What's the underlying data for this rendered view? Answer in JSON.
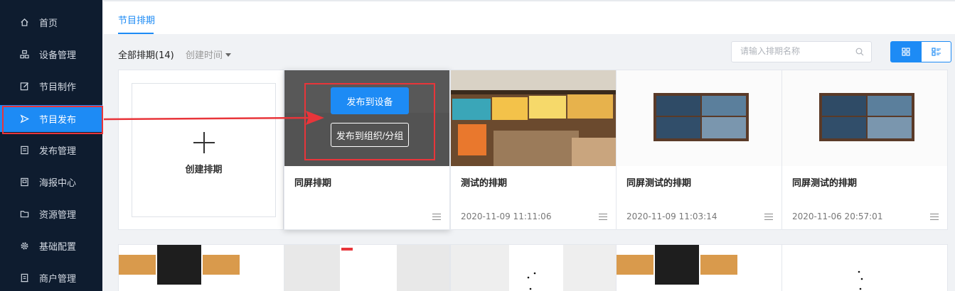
{
  "sidebar": {
    "items": [
      {
        "label": "首页",
        "icon": "home-icon"
      },
      {
        "label": "设备管理",
        "icon": "device-icon"
      },
      {
        "label": "节目制作",
        "icon": "edit-icon"
      },
      {
        "label": "节目发布",
        "icon": "send-icon",
        "active": true
      },
      {
        "label": "发布管理",
        "icon": "list-icon"
      },
      {
        "label": "海报中心",
        "icon": "poster-icon"
      },
      {
        "label": "资源管理",
        "icon": "folder-icon"
      },
      {
        "label": "基础配置",
        "icon": "gear-icon"
      },
      {
        "label": "商户管理",
        "icon": "merchant-icon"
      }
    ]
  },
  "tabs": [
    {
      "label": "节目排期",
      "active": true
    }
  ],
  "filter": {
    "all_label": "全部排期(14)",
    "sort_label": "创建时间"
  },
  "search": {
    "placeholder": "请输入排期名称"
  },
  "view_toggle": {
    "active": "grid"
  },
  "create_card": {
    "label": "创建排期"
  },
  "overlay": {
    "publish_device": "发布到设备",
    "publish_group": "发布到组织/分组"
  },
  "cards": [
    {
      "title": "同屏排期",
      "date": ""
    },
    {
      "title": "测试的排期",
      "date": "2020-11-09 11:11:06"
    },
    {
      "title": "同屏测试的排期",
      "date": "2020-11-09 11:03:14"
    },
    {
      "title": "同屏测试的排期",
      "date": "2020-11-06 20:57:01"
    }
  ],
  "colors": {
    "accent": "#1d8bf5",
    "sidebar_bg": "#0e1c2f",
    "highlight": "#e8353a"
  }
}
